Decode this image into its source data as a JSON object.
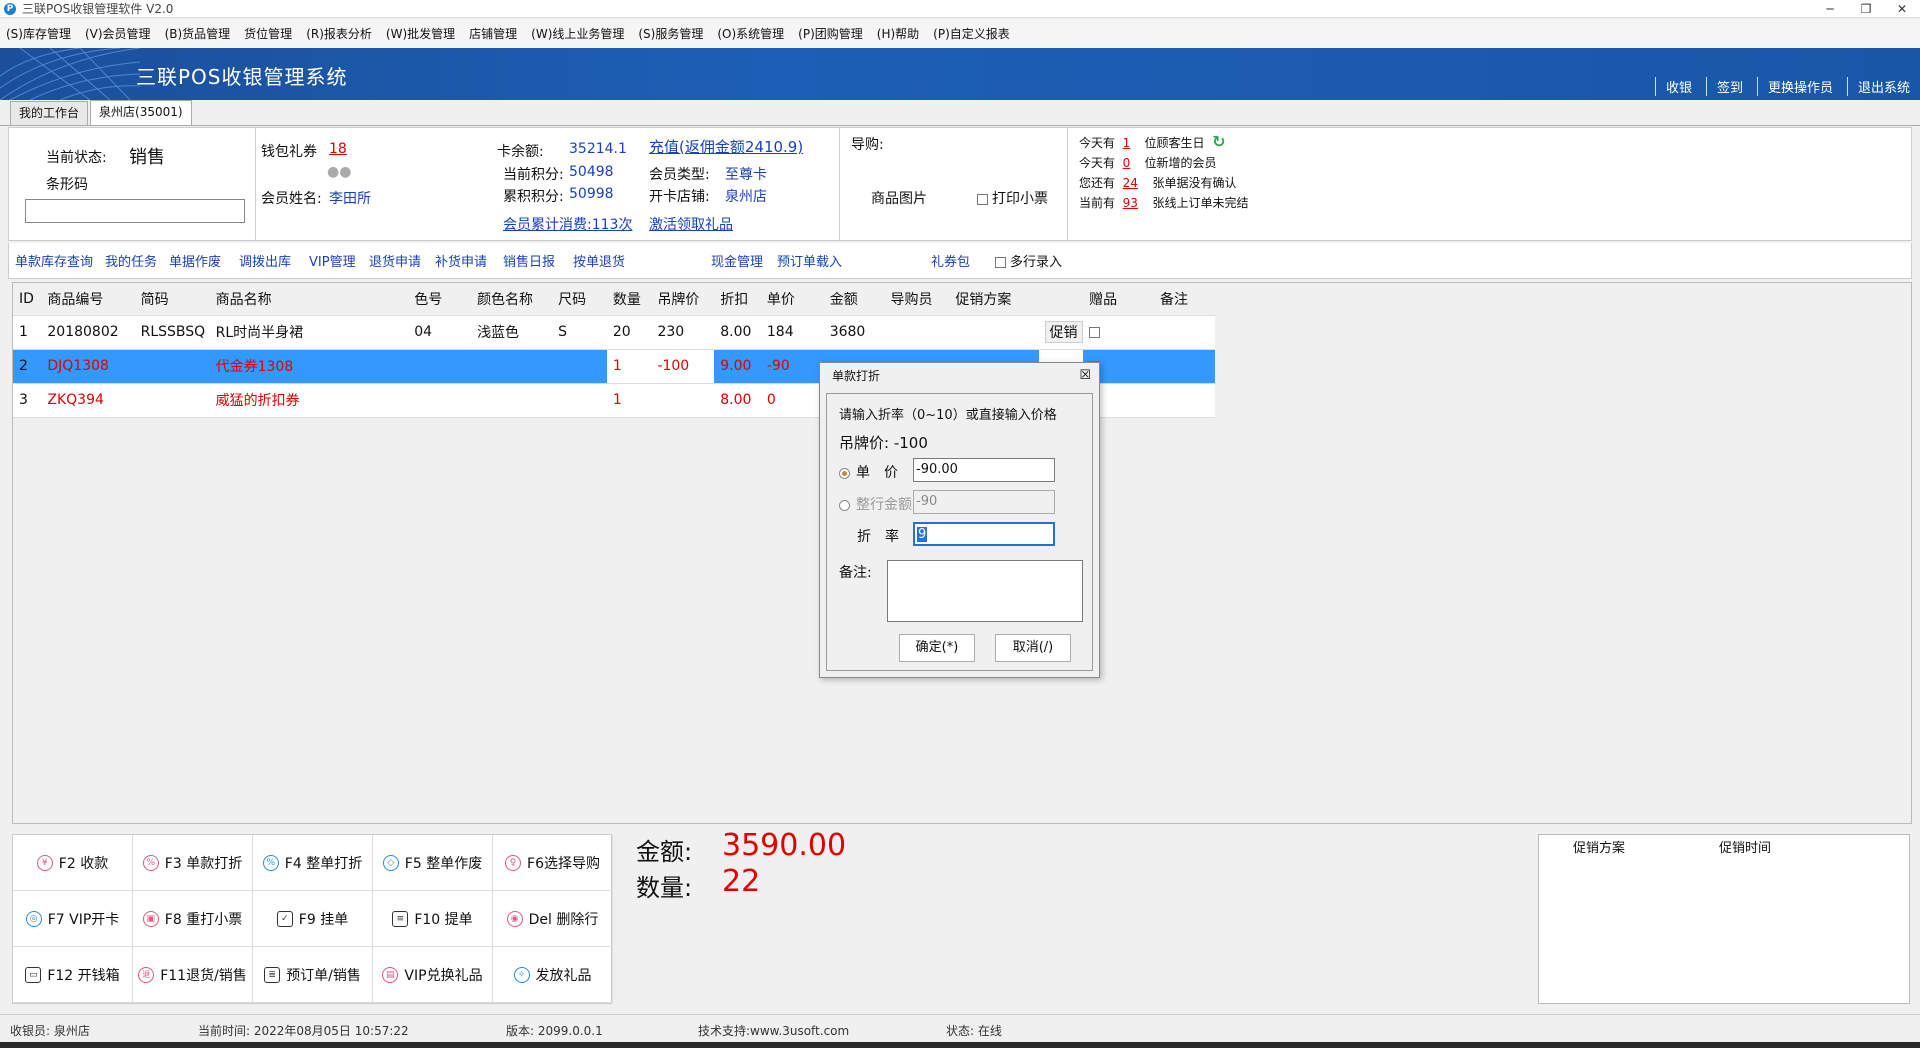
{
  "window": {
    "title": "三联POS收银管理软件 V2.0",
    "app_icon": "P"
  },
  "menu": [
    "(S)库存管理",
    "(V)会员管理",
    "(B)货品管理",
    "货位管理",
    "(R)报表分析",
    "(W)批发管理",
    "店铺管理",
    "(W)线上业务管理",
    "(S)服务管理",
    "(O)系统管理",
    "(P)团购管理",
    "(H)帮助",
    "(P)自定义报表"
  ],
  "banner": {
    "title": "三联POS收银管理系统",
    "links": [
      "收银",
      "签到",
      "更换操作员",
      "退出系统"
    ]
  },
  "tabs": [
    "我的工作台",
    "泉州店(35001)"
  ],
  "info": {
    "status_label": "当前状态:",
    "status_value": "销售",
    "barcode_label": "条形码",
    "wallet_label": "钱包礼券",
    "wallet_value": "18",
    "member_name_label": "会员姓名:",
    "member_name": "李田所",
    "card_balance_label": "卡余额:",
    "card_balance": "35214.1",
    "recharge_link": "充值(返佣金额2410.9)",
    "points_label": "当前积分:",
    "points": "50498",
    "member_type_label": "会员类型:",
    "member_type": "至尊卡",
    "acc_points_label": "累积积分:",
    "acc_points": "50998",
    "card_store_label": "开卡店铺:",
    "card_store": "泉州店",
    "consume_link": "会员累计消费:113次",
    "activate_link": "激活领取礼品",
    "guide_label": "导购:",
    "product_img_label": "商品图片",
    "print_receipt_label": "打印小票",
    "notice": [
      {
        "pre": "今天有",
        "num": "1",
        "post": "位顾客生日"
      },
      {
        "pre": "今天有",
        "num": "0",
        "post": "位新增的会员"
      },
      {
        "pre": "您还有",
        "num": "24",
        "post": "张单据没有确认"
      },
      {
        "pre": "当前有",
        "num": "93",
        "post": "张线上订单未完结"
      }
    ]
  },
  "toolbar": [
    "单款库存查询",
    "我的任务",
    "单据作废",
    "调拨出库",
    "VIP管理",
    "退货申请",
    "补货申请",
    "销售日报",
    "按单退货",
    "现金管理",
    "预订单载入",
    "礼券包",
    "多行录入"
  ],
  "grid": {
    "headers": [
      "ID",
      "商品编号",
      "简码",
      "商品名称",
      "色号",
      "颜色名称",
      "尺码",
      "数量",
      "吊牌价",
      "折扣",
      "单价",
      "金额",
      "导购员",
      "促销方案",
      "",
      "赠品",
      "备注"
    ],
    "rows": [
      [
        "1",
        "20180802",
        "RLSSBSQ",
        "RL时尚半身裙",
        "04",
        "浅蓝色",
        "S",
        "20",
        "230",
        "8.00",
        "184",
        "3680",
        "",
        "",
        "促销",
        "",
        ""
      ],
      [
        "2",
        "DJQ1308",
        "",
        "代金券1308",
        "",
        "",
        "",
        "1",
        "-100",
        "9.00",
        "-90",
        "",
        "",
        "",
        "",
        "",
        ""
      ],
      [
        "3",
        "ZKQ394",
        "",
        "威猛的折扣券",
        "",
        "",
        "",
        "1",
        "",
        "8.00",
        "0",
        "",
        "",
        "",
        "",
        "",
        ""
      ]
    ]
  },
  "dialog": {
    "title": "单款打折",
    "close": "☒",
    "prompt": "请输入折率（0~10）或直接输入价格",
    "tag_price": "吊牌价: -100",
    "unit_price_label": "单　价",
    "unit_price": "-90.00",
    "row_amount_label": "整行金额",
    "row_amount": "-90",
    "rate_label": "折　率",
    "rate": "9",
    "note_label": "备注:",
    "ok": "确定(*)",
    "cancel": "取消(/)"
  },
  "fkeys": [
    {
      "icon": "yuan-icon",
      "glyph": "¥",
      "label": "F2 收款"
    },
    {
      "icon": "discount-icon",
      "glyph": "%",
      "label": "F3 单款打折"
    },
    {
      "icon": "discount-icon",
      "glyph": "%",
      "label": "F4 整单打折"
    },
    {
      "icon": "eraser-icon",
      "glyph": "◇",
      "label": "F5 整单作废"
    },
    {
      "icon": "person-icon",
      "glyph": "♀",
      "label": "F6选择导购"
    },
    {
      "icon": "vip-card-icon",
      "glyph": "◎",
      "label": "F7 VIP开卡"
    },
    {
      "icon": "printer-icon",
      "glyph": "▣",
      "label": "F8 重打小票"
    },
    {
      "icon": "hang-icon",
      "glyph": "✓",
      "label": "F9 挂单"
    },
    {
      "icon": "doc-icon",
      "glyph": "≡",
      "label": "F10 提单"
    },
    {
      "icon": "delete-icon",
      "glyph": "◉",
      "label": "Del 删除行"
    },
    {
      "icon": "cashbox-icon",
      "glyph": "▭",
      "label": "F12 开钱箱"
    },
    {
      "icon": "return-icon",
      "glyph": "退",
      "label": "F11退货/销售"
    },
    {
      "icon": "order-icon",
      "glyph": "≣",
      "label": "预订单/销售"
    },
    {
      "icon": "gift-exchange-icon",
      "glyph": "▤",
      "label": "VIP兑换礼品"
    },
    {
      "icon": "gift-icon",
      "glyph": "✧",
      "label": "发放礼品"
    }
  ],
  "totals": {
    "amount_label": "金额:",
    "amount": "3590.00",
    "qty_label": "数量:",
    "qty": "22"
  },
  "promo_panel": {
    "headers": [
      "促销方案",
      "促销时间"
    ]
  },
  "status": {
    "cashier": "收银员: 泉州店",
    "time": "当前时间:    2022年08月05日 10:57:22",
    "version": "版本: 2099.0.0.1",
    "support": "技术支持:www.3usoft.com",
    "state": "状态: 在线"
  }
}
